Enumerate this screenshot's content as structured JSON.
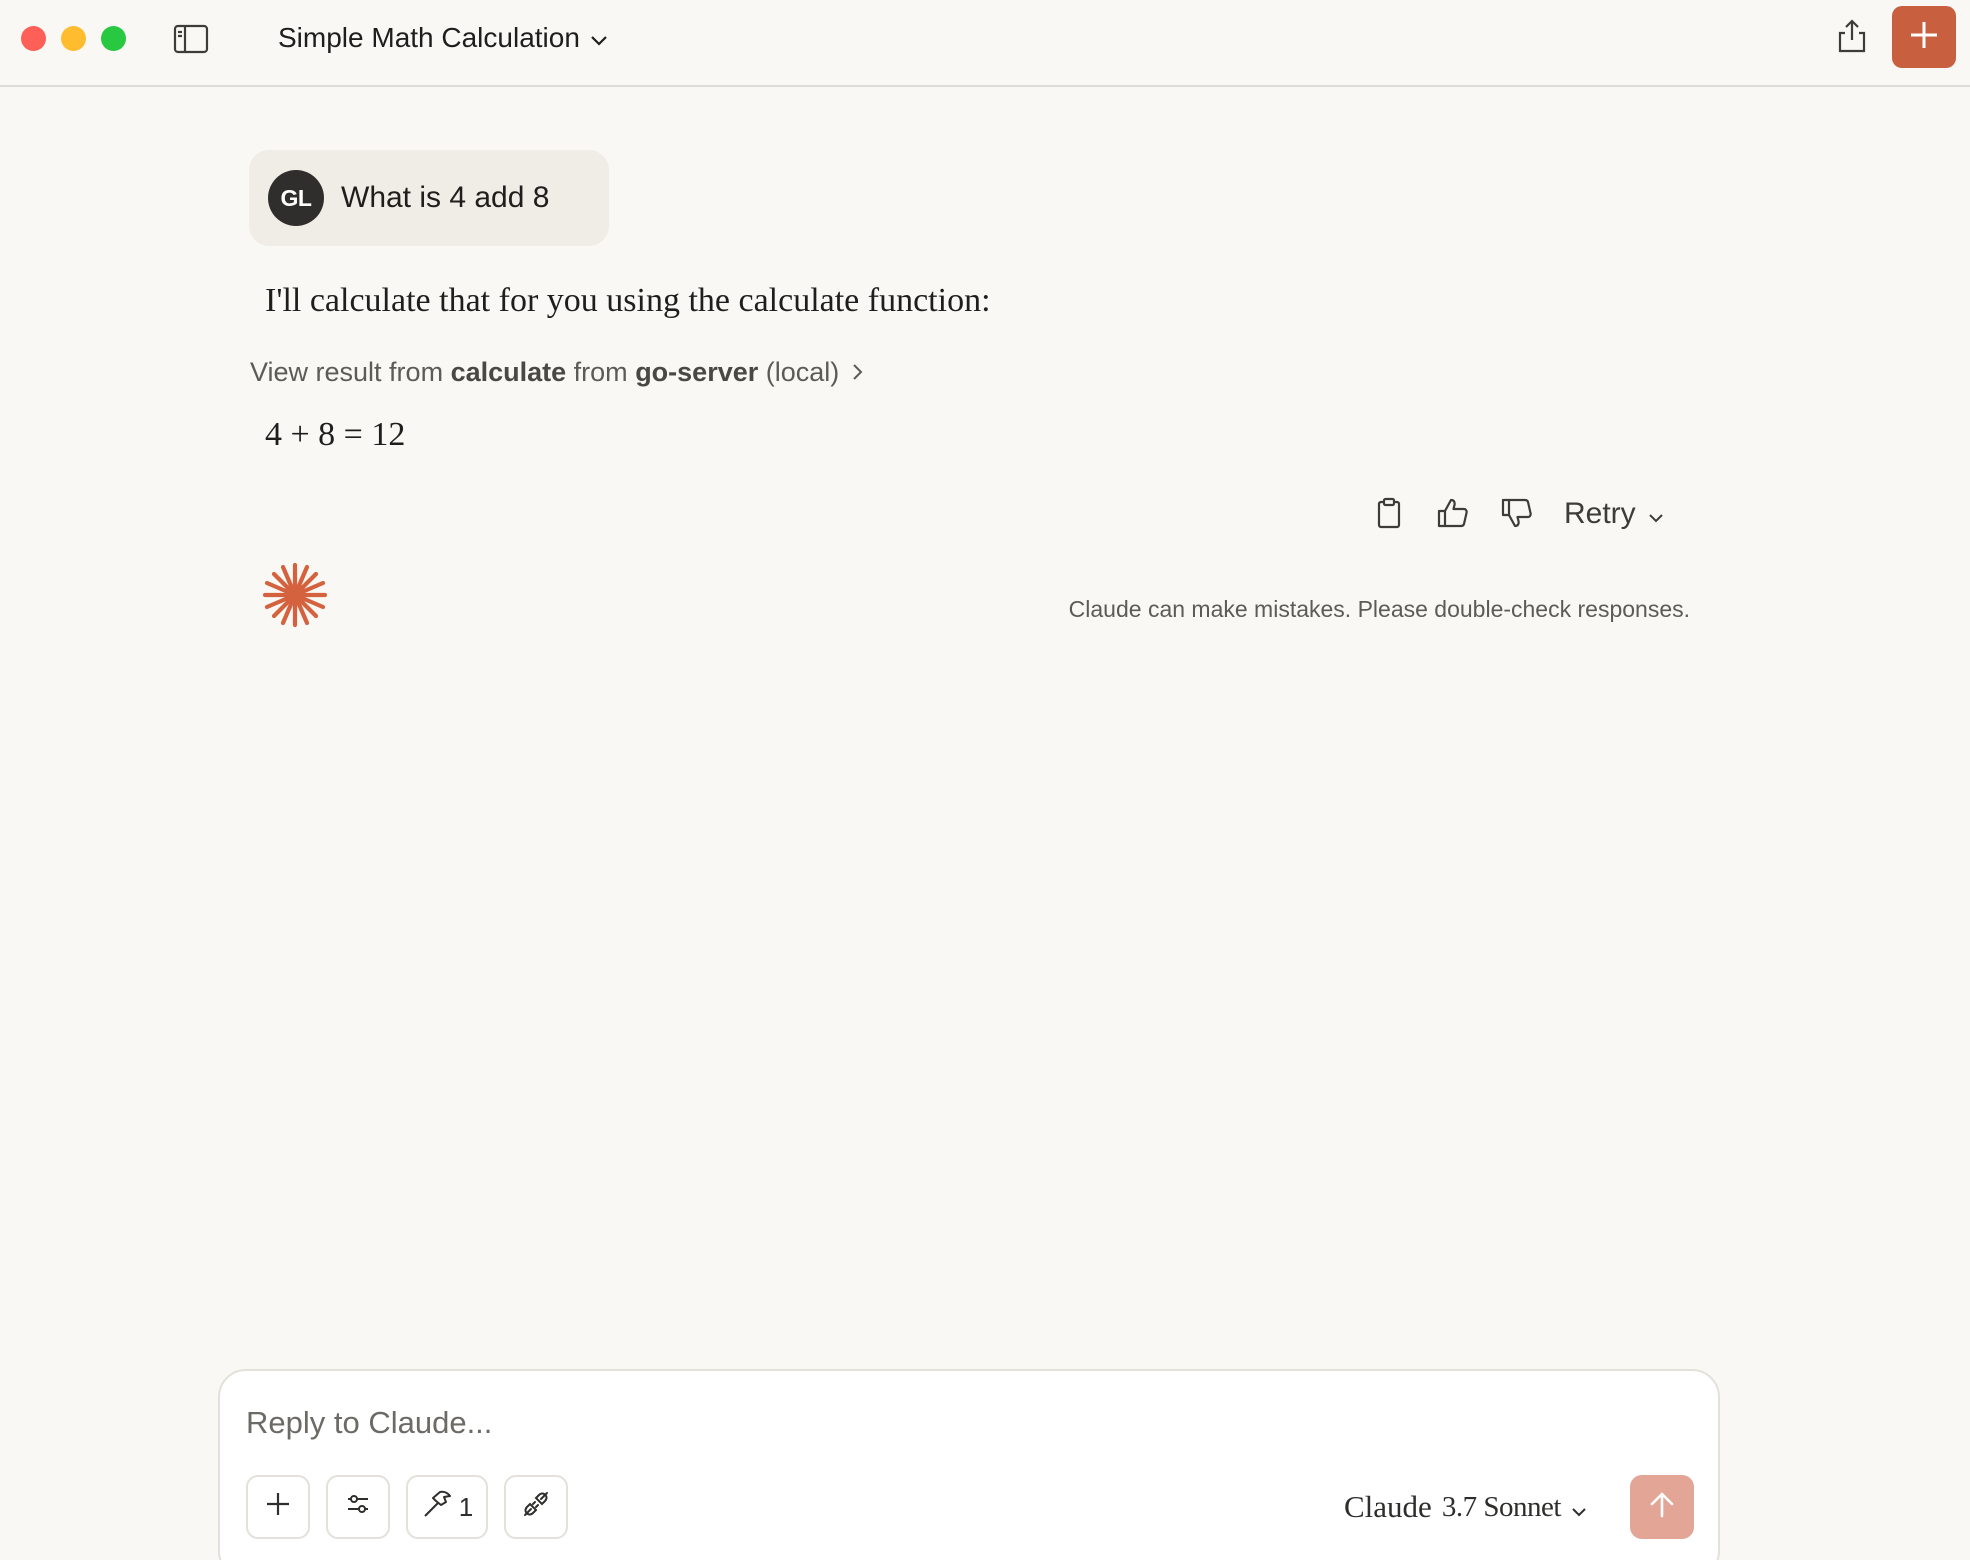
{
  "window": {
    "title": "Simple Math Calculation"
  },
  "conversation": {
    "user_message": {
      "avatar_initials": "GL",
      "text": "What is 4 add 8"
    },
    "assistant": {
      "intro": "I'll calculate that for you using the calculate function:",
      "tool_result": {
        "prefix": "View result from",
        "tool_name": "calculate",
        "middle": "from",
        "server_name": "go-server",
        "suffix": "(local)"
      },
      "answer": "4 + 8 = 12"
    },
    "actions": {
      "retry_label": "Retry"
    },
    "disclaimer": "Claude can make mistakes. Please double-check responses."
  },
  "composer": {
    "placeholder": "Reply to Claude...",
    "tools_count": "1",
    "model_name": "Claude",
    "model_version": "3.7 Sonnet"
  },
  "colors": {
    "accent": "#c8603f",
    "send_disabled": "#e2a596",
    "background": "#f9f8f4",
    "user_bubble": "#efede6"
  },
  "icons": {
    "sidebar_toggle": "sidebar-toggle-icon",
    "share": "share-icon",
    "new_chat": "plus-icon",
    "copy": "clipboard-icon",
    "thumbs_up": "thumbs-up-icon",
    "thumbs_down": "thumbs-down-icon",
    "logo": "claude-sparkle-icon",
    "attach": "plus-icon",
    "settings": "sliders-icon",
    "tools": "hammer-icon",
    "integrations": "plug-icon",
    "send": "arrow-up-icon"
  }
}
